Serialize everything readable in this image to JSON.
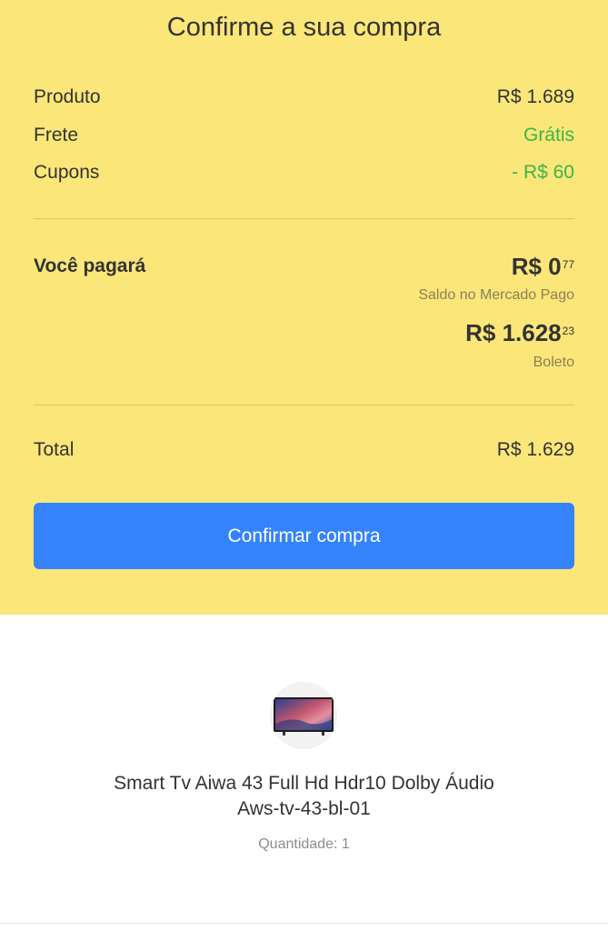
{
  "header": {
    "title": "Confirme a sua compra"
  },
  "summary": {
    "product_label": "Produto",
    "product_value": "R$ 1.689",
    "shipping_label": "Frete",
    "shipping_value": "Grátis",
    "coupons_label": "Cupons",
    "coupons_value": "- R$ 60"
  },
  "payment": {
    "label": "Você pagará",
    "methods": [
      {
        "amount_main": "R$ 0",
        "amount_cents": "77",
        "method": "Saldo no Mercado Pago"
      },
      {
        "amount_main": "R$ 1.628",
        "amount_cents": "23",
        "method": "Boleto"
      }
    ]
  },
  "total": {
    "label": "Total",
    "value": "R$ 1.629"
  },
  "actions": {
    "confirm_label": "Confirmar compra"
  },
  "product": {
    "name_line1": "Smart Tv Aiwa 43 Full Hd Hdr10 Dolby Áudio",
    "name_line2": "Aws-tv-43-bl-01",
    "quantity": "Quantidade: 1",
    "thumbnail_icon": "tv-icon"
  },
  "colors": {
    "background_top": "#fbe679",
    "accent_button": "#3483fa",
    "free_green": "#39b54a"
  }
}
